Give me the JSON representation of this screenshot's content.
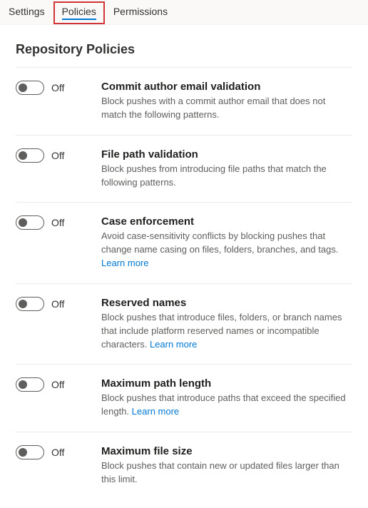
{
  "tabs": {
    "items": [
      {
        "label": "Settings",
        "selected": false,
        "highlighted": false
      },
      {
        "label": "Policies",
        "selected": true,
        "highlighted": true
      },
      {
        "label": "Permissions",
        "selected": false,
        "highlighted": false
      }
    ]
  },
  "section": {
    "title": "Repository Policies"
  },
  "toggle": {
    "off_label": "Off"
  },
  "learn_more": "Learn more",
  "policies": [
    {
      "id": "commit-author-email",
      "title": "Commit author email validation",
      "desc": "Block pushes with a commit author email that does not match the following patterns.",
      "state": "off",
      "learn_more": false
    },
    {
      "id": "file-path-validation",
      "title": "File path validation",
      "desc": "Block pushes from introducing file paths that match the following patterns.",
      "state": "off",
      "learn_more": false
    },
    {
      "id": "case-enforcement",
      "title": "Case enforcement",
      "desc": "Avoid case-sensitivity conflicts by blocking pushes that change name casing on files, folders, branches, and tags.",
      "state": "off",
      "learn_more": true
    },
    {
      "id": "reserved-names",
      "title": "Reserved names",
      "desc": "Block pushes that introduce files, folders, or branch names that include platform reserved names or incompatible characters.",
      "state": "off",
      "learn_more": true
    },
    {
      "id": "max-path-length",
      "title": "Maximum path length",
      "desc": "Block pushes that introduce paths that exceed the specified length.",
      "state": "off",
      "learn_more": true
    },
    {
      "id": "max-file-size",
      "title": "Maximum file size",
      "desc": "Block pushes that contain new or updated files larger than this limit.",
      "state": "off",
      "learn_more": false
    }
  ]
}
